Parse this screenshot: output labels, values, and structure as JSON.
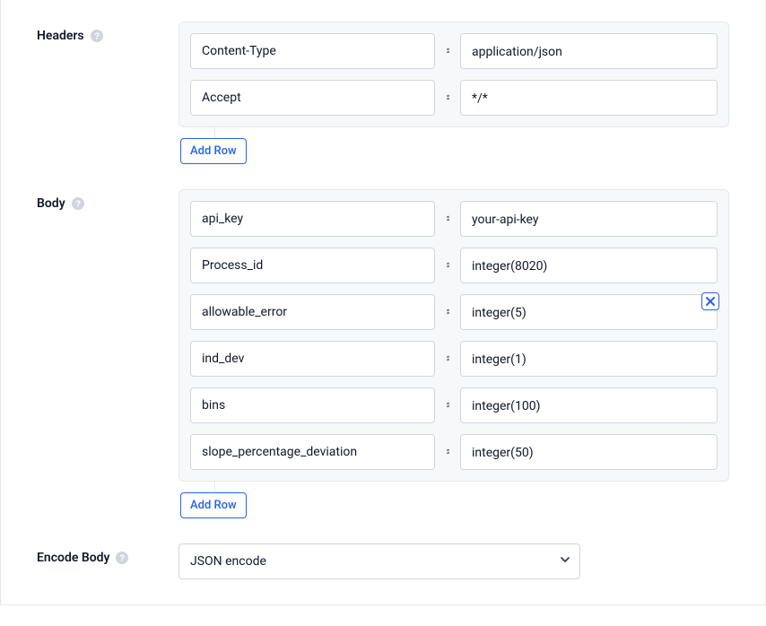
{
  "headers": {
    "label": "Headers",
    "add_row_label": "Add Row",
    "rows": [
      {
        "key": "Content-Type",
        "value": "application/json"
      },
      {
        "key": "Accept",
        "value": "*/*"
      }
    ]
  },
  "body": {
    "label": "Body",
    "add_row_label": "Add Row",
    "rows": [
      {
        "key": "api_key",
        "value": "your-api-key"
      },
      {
        "key": "Process_id",
        "value": "integer(8020)"
      },
      {
        "key": "allowable_error",
        "value": "integer(5)",
        "show_delete": true
      },
      {
        "key": "ind_dev",
        "value": "integer(1)"
      },
      {
        "key": "bins",
        "value": "integer(100)"
      },
      {
        "key": "slope_percentage_deviation",
        "value": "integer(50)"
      }
    ]
  },
  "encode_body": {
    "label": "Encode Body",
    "selected": "JSON encode"
  }
}
